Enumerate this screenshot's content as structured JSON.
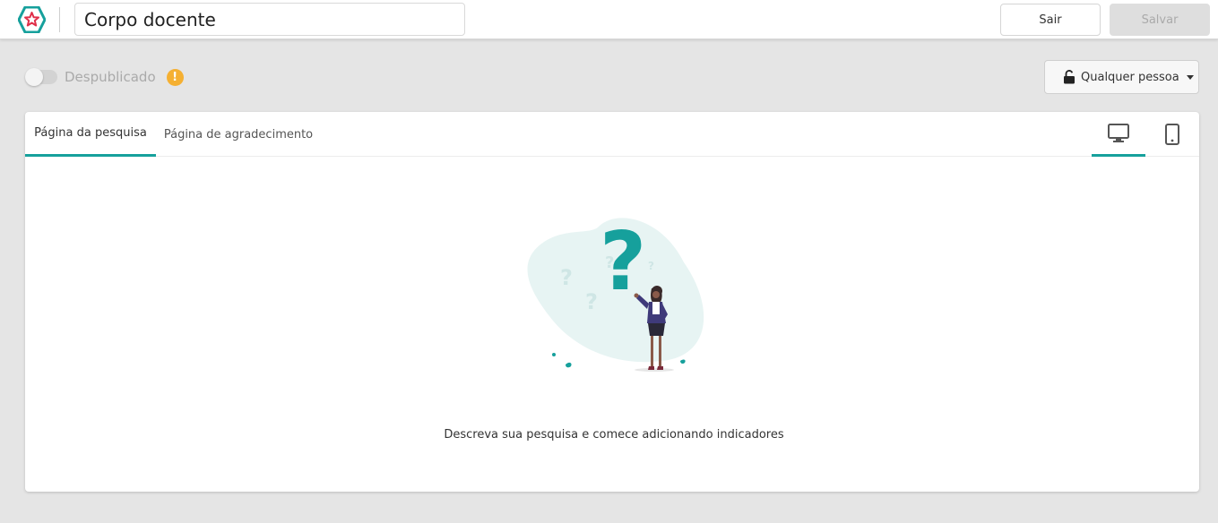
{
  "header": {
    "title_value": "Corpo docente",
    "exit_label": "Sair",
    "save_label": "Salvar"
  },
  "publish": {
    "status_label": "Despublicado",
    "toggle_on": false,
    "warning_icon": "exclamation-circle-icon"
  },
  "access": {
    "label": "Qualquer pessoa",
    "icon": "unlock-icon"
  },
  "tabs": [
    {
      "label": "Página da pesquisa",
      "active": true
    },
    {
      "label": "Página de agradecimento",
      "active": false
    }
  ],
  "devices": [
    {
      "icon": "desktop-icon",
      "active": true
    },
    {
      "icon": "mobile-icon",
      "active": false
    }
  ],
  "empty_state": {
    "message": "Descreva sua pesquisa e comece adicionando indicadores"
  },
  "colors": {
    "accent": "#16a09c",
    "warning": "#f5b032",
    "logo_red": "#e0304a"
  }
}
